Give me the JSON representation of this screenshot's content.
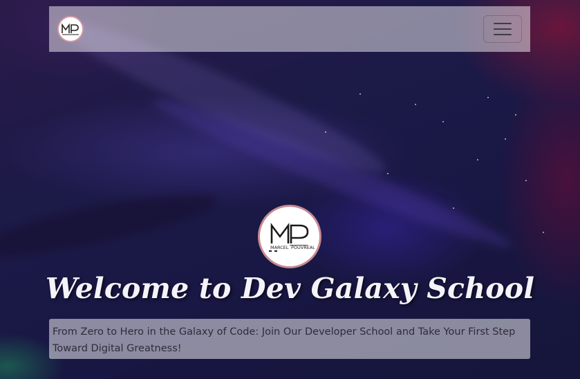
{
  "navbar": {
    "logo_alt": "Marcel Pouvreau logo",
    "toggler_label": "Toggle navigation"
  },
  "logo": {
    "monogram": "MP",
    "first_name": "MARCEL",
    "last_name": "POUVREAU"
  },
  "hero": {
    "title": "Welcome to Dev Galaxy School",
    "subtitle": "From Zero to Hero in the Galaxy of Code: Join Our Developer School and Take Your First Step Toward Digital Greatness!"
  },
  "colors": {
    "logo_ring": "#c98a92",
    "title_text": "#f4f3f9",
    "background_deep": "#191744"
  },
  "icons": {
    "menu": "hamburger-icon"
  }
}
